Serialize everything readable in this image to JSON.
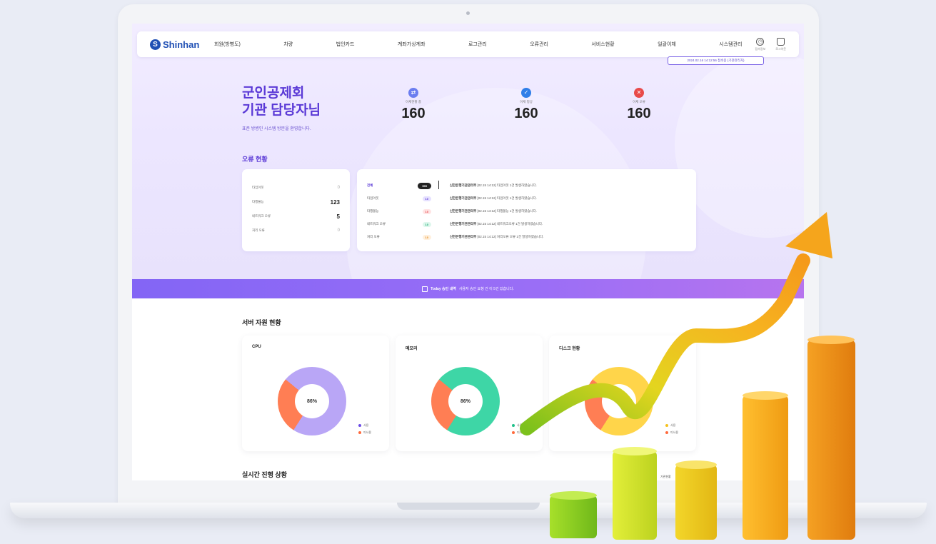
{
  "brand": {
    "name": "Shinhan"
  },
  "nav": {
    "items": [
      "회원(방병도)",
      "차량",
      "법인카드",
      "계좌가상계좌",
      "로그관리",
      "오류관리",
      "서비스현황",
      "일괄이체",
      "시스템관리"
    ],
    "icons": [
      {
        "icon": "clock-icon",
        "label": "접속정보"
      },
      {
        "icon": "lock-icon",
        "label": "로그아웃"
      }
    ],
    "login_info": "2024.02.16 14:12:56 접속중 (기관관리자)"
  },
  "greeting": {
    "line1": "군인공제회",
    "line2": "기관 담당자님",
    "sub": "표준 방병인 시스템 방문을 환영합니다."
  },
  "stats": [
    {
      "label": "이체현황 총",
      "value": "160",
      "icon": "transfer-icon",
      "color": "#6b7df0"
    },
    {
      "label": "이체 정상",
      "value": "160",
      "icon": "check-icon",
      "color": "#2f7ee8"
    },
    {
      "label": "이체 오류",
      "value": "160",
      "icon": "close-icon",
      "color": "#e84a4a"
    }
  ],
  "error_status": {
    "title": "오류 현황",
    "summary": [
      {
        "label": "타임아웃",
        "value": "0"
      },
      {
        "label": "타행불능",
        "value": "123"
      },
      {
        "label": "네트워크 오류",
        "value": "5"
      },
      {
        "label": "처리 오류",
        "value": "0"
      }
    ],
    "categories": [
      {
        "label": "전체",
        "count": "999",
        "style": "dark"
      },
      {
        "label": "타임아웃",
        "count": "10",
        "style": "blue"
      },
      {
        "label": "타행불능",
        "count": "10",
        "style": "red"
      },
      {
        "label": "네트워크 오류",
        "count": "10",
        "style": "green"
      },
      {
        "label": "처리 오류",
        "count": "10",
        "style": "orange"
      }
    ],
    "messages": [
      {
        "org": "신한은행기관관리부",
        "text": "[02.15 14:12] 타임아웃 1건 발생하였습니다."
      },
      {
        "org": "신한은행기관관리부",
        "text": "[02.15 14:12] 타임아웃 1건 발생하였습니다."
      },
      {
        "org": "신한은행기관관리부",
        "text": "[02.15 14:12] 타행불능 1건 발생하였습니다."
      },
      {
        "org": "신한은행기관관리부",
        "text": "[02.15 14:12] 네트워크오류 1건 발생하였습니다."
      },
      {
        "org": "신한은행기관관리부",
        "text": "[02.15 14:12] 처리오류 오류 1건 발생하였습니다."
      }
    ]
  },
  "banner": {
    "highlight": "Today 승인 내역",
    "text": "사용자 승인 요청 건 이 5건 있습니다."
  },
  "server": {
    "title": "서버 자원 현황",
    "cards": [
      {
        "title": "CPU",
        "percent": 86,
        "label": "86%",
        "used_color": "#b9a6f6",
        "free_color": "#ff7e54",
        "legend": [
          "사용",
          "미사용"
        ]
      },
      {
        "title": "메모리",
        "percent": 86,
        "label": "86%",
        "used_color": "#3ed6a6",
        "free_color": "#ff7e54",
        "legend": [
          "사용",
          "미사용"
        ]
      },
      {
        "title": "디스크 현황",
        "percent": 86,
        "label": "",
        "used_color": "#ffd54a",
        "free_color": "#ff7e54",
        "legend": [
          "사용",
          "미사용"
        ]
      }
    ]
  },
  "live": {
    "title": "실시간 진행 상황",
    "right": "기관현황"
  },
  "colors": {
    "accent": "#5a39d6",
    "brand": "#1f4fb4"
  }
}
